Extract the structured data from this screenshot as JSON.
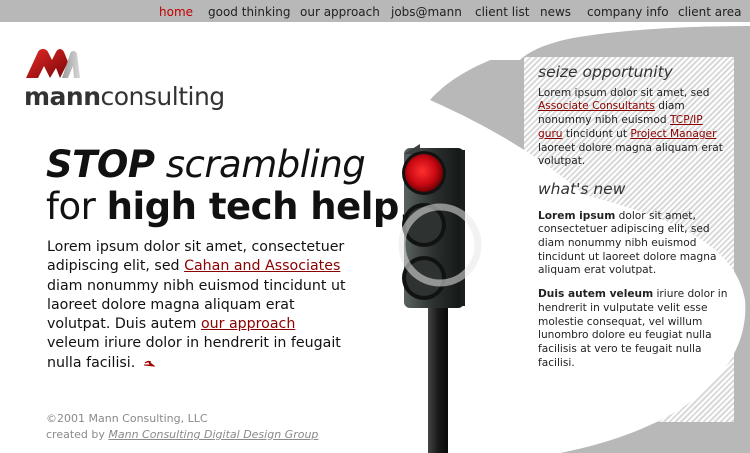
{
  "nav": {
    "items": [
      {
        "label": "home",
        "active": true
      },
      {
        "label": "good thinking"
      },
      {
        "label": "our approach"
      },
      {
        "label": "jobs@mann"
      },
      {
        "label": "client list"
      },
      {
        "label": "news"
      },
      {
        "label": "company info"
      },
      {
        "label": "client area"
      }
    ]
  },
  "logo": {
    "bold": "mann",
    "light": "consulting",
    "accent_color": "#c01010"
  },
  "headline": {
    "line1_bold": "STOP",
    "line1_rest": " scrambling",
    "line2_pre": "for ",
    "line2_bold": "high tech help",
    "line2_post": "."
  },
  "body": {
    "p1": "Lorem ipsum dolor sit amet, consectetuer adipiscing elit, sed ",
    "link1": "Cahan and Associates",
    "p2": " diam nonummy nibh euismod tincidunt ut laoreet dolore magna aliquam erat volutpat. Duis autem ",
    "link2": "our approach",
    "p3": " veleum iriure dolor in hendrerit in feugait nulla facilisi."
  },
  "footer": {
    "copyright": "©2001 Mann Consulting, LLC",
    "created_by": "created by ",
    "created_link": "Mann Consulting Digital Design Group"
  },
  "sidebar": {
    "section1": {
      "title": "seize opportunity",
      "t1": "Lorem ipsum dolor sit amet, sed ",
      "link1": "Associate Consultants",
      "t2": " diam nonummy nibh euismod ",
      "link2": "TCP/IP guru",
      "t3": " tincidunt ut ",
      "link3": "Project Manager",
      "t4": " laoreet dolore magna aliquam erat volutpat."
    },
    "section2": {
      "title": "what's new",
      "p1_bold": "Lorem ipsum",
      "p1_rest": " dolor sit amet, consectetuer adipiscing elit, sed diam nonummy nibh euismod tincidunt ut laoreet dolore magna aliquam erat volutpat.",
      "p2_bold": "Duis autem veleum",
      "p2_rest": " iriure dolor in hendrerit in vulputate velit esse molestie consequat, vel willum lunombro dolore eu feugiat nulla facilisis at vero te feugait nulla facilisi."
    }
  },
  "colors": {
    "link": "#8b0000",
    "nav_active": "#c00000",
    "background_gray": "#b8b8b8"
  }
}
